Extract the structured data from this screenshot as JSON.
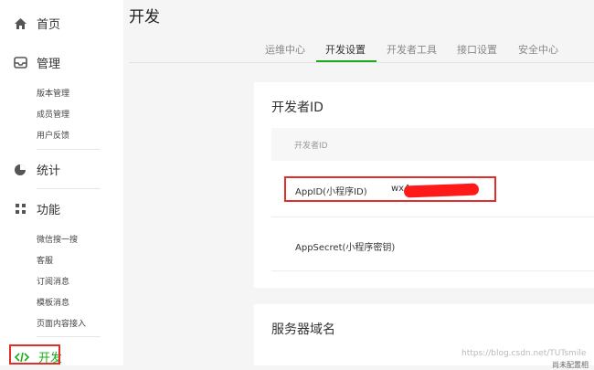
{
  "sidebar": {
    "home": "首页",
    "manage": {
      "label": "管理",
      "items": [
        "版本管理",
        "成员管理",
        "用户反馈"
      ]
    },
    "stats": "统计",
    "features": {
      "label": "功能",
      "items": [
        "微信搜一搜",
        "客服",
        "订阅消息",
        "模板消息",
        "页面内容接入"
      ]
    },
    "dev": "开发"
  },
  "page": {
    "title": "开发"
  },
  "tabs": [
    "运维中心",
    "开发设置",
    "开发者工具",
    "接口设置",
    "安全中心"
  ],
  "developer_card": {
    "title": "开发者ID",
    "table_header": "开发者ID",
    "appid_label": "AppID(小程序ID)",
    "appid_value": "wx4",
    "secret_label": "AppSecret(小程序密钥)"
  },
  "server_card": {
    "title": "服务器域名"
  },
  "watermark": "https://blog.csdn.net/TUTsmile",
  "corner_text": "尚未配置相"
}
